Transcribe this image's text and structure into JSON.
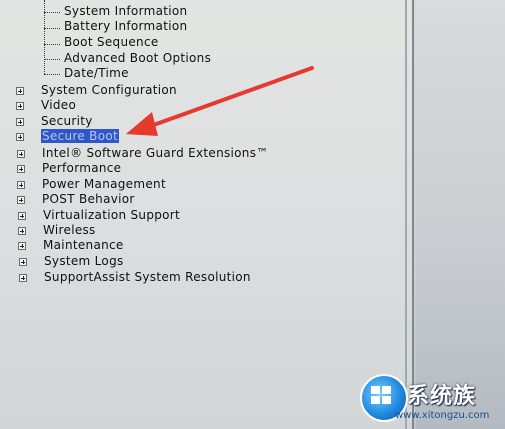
{
  "tree": {
    "general_children": [
      "System Information",
      "Battery Information",
      "Boot Sequence",
      "Advanced Boot Options",
      "Date/Time"
    ],
    "items": [
      "System Configuration",
      "Video",
      "Security",
      "Secure Boot",
      "Intel® Software Guard Extensions™",
      "Performance",
      "Power Management",
      "POST Behavior",
      "Virtualization Support",
      "Wireless",
      "Maintenance",
      "System Logs",
      "SupportAssist System Resolution"
    ],
    "selected_item": "Secure Boot"
  },
  "annotation": {
    "arrow_color": "#e53a2e"
  },
  "watermark": {
    "brand_text": "系统族",
    "url_text": "www.xitongzu.com"
  }
}
